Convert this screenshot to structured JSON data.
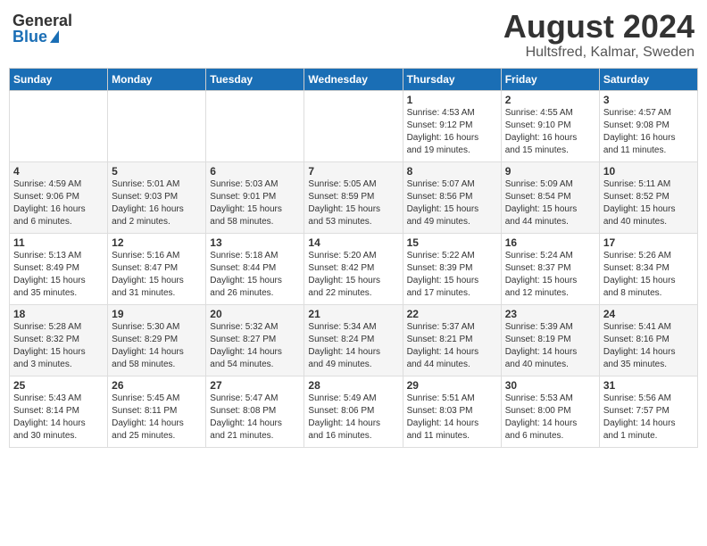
{
  "logo": {
    "general": "General",
    "blue": "Blue"
  },
  "title": {
    "month": "August 2024",
    "location": "Hultsfred, Kalmar, Sweden"
  },
  "weekdays": [
    "Sunday",
    "Monday",
    "Tuesday",
    "Wednesday",
    "Thursday",
    "Friday",
    "Saturday"
  ],
  "weeks": [
    [
      {
        "day": "",
        "info": ""
      },
      {
        "day": "",
        "info": ""
      },
      {
        "day": "",
        "info": ""
      },
      {
        "day": "",
        "info": ""
      },
      {
        "day": "1",
        "info": "Sunrise: 4:53 AM\nSunset: 9:12 PM\nDaylight: 16 hours\nand 19 minutes."
      },
      {
        "day": "2",
        "info": "Sunrise: 4:55 AM\nSunset: 9:10 PM\nDaylight: 16 hours\nand 15 minutes."
      },
      {
        "day": "3",
        "info": "Sunrise: 4:57 AM\nSunset: 9:08 PM\nDaylight: 16 hours\nand 11 minutes."
      }
    ],
    [
      {
        "day": "4",
        "info": "Sunrise: 4:59 AM\nSunset: 9:06 PM\nDaylight: 16 hours\nand 6 minutes."
      },
      {
        "day": "5",
        "info": "Sunrise: 5:01 AM\nSunset: 9:03 PM\nDaylight: 16 hours\nand 2 minutes."
      },
      {
        "day": "6",
        "info": "Sunrise: 5:03 AM\nSunset: 9:01 PM\nDaylight: 15 hours\nand 58 minutes."
      },
      {
        "day": "7",
        "info": "Sunrise: 5:05 AM\nSunset: 8:59 PM\nDaylight: 15 hours\nand 53 minutes."
      },
      {
        "day": "8",
        "info": "Sunrise: 5:07 AM\nSunset: 8:56 PM\nDaylight: 15 hours\nand 49 minutes."
      },
      {
        "day": "9",
        "info": "Sunrise: 5:09 AM\nSunset: 8:54 PM\nDaylight: 15 hours\nand 44 minutes."
      },
      {
        "day": "10",
        "info": "Sunrise: 5:11 AM\nSunset: 8:52 PM\nDaylight: 15 hours\nand 40 minutes."
      }
    ],
    [
      {
        "day": "11",
        "info": "Sunrise: 5:13 AM\nSunset: 8:49 PM\nDaylight: 15 hours\nand 35 minutes."
      },
      {
        "day": "12",
        "info": "Sunrise: 5:16 AM\nSunset: 8:47 PM\nDaylight: 15 hours\nand 31 minutes."
      },
      {
        "day": "13",
        "info": "Sunrise: 5:18 AM\nSunset: 8:44 PM\nDaylight: 15 hours\nand 26 minutes."
      },
      {
        "day": "14",
        "info": "Sunrise: 5:20 AM\nSunset: 8:42 PM\nDaylight: 15 hours\nand 22 minutes."
      },
      {
        "day": "15",
        "info": "Sunrise: 5:22 AM\nSunset: 8:39 PM\nDaylight: 15 hours\nand 17 minutes."
      },
      {
        "day": "16",
        "info": "Sunrise: 5:24 AM\nSunset: 8:37 PM\nDaylight: 15 hours\nand 12 minutes."
      },
      {
        "day": "17",
        "info": "Sunrise: 5:26 AM\nSunset: 8:34 PM\nDaylight: 15 hours\nand 8 minutes."
      }
    ],
    [
      {
        "day": "18",
        "info": "Sunrise: 5:28 AM\nSunset: 8:32 PM\nDaylight: 15 hours\nand 3 minutes."
      },
      {
        "day": "19",
        "info": "Sunrise: 5:30 AM\nSunset: 8:29 PM\nDaylight: 14 hours\nand 58 minutes."
      },
      {
        "day": "20",
        "info": "Sunrise: 5:32 AM\nSunset: 8:27 PM\nDaylight: 14 hours\nand 54 minutes."
      },
      {
        "day": "21",
        "info": "Sunrise: 5:34 AM\nSunset: 8:24 PM\nDaylight: 14 hours\nand 49 minutes."
      },
      {
        "day": "22",
        "info": "Sunrise: 5:37 AM\nSunset: 8:21 PM\nDaylight: 14 hours\nand 44 minutes."
      },
      {
        "day": "23",
        "info": "Sunrise: 5:39 AM\nSunset: 8:19 PM\nDaylight: 14 hours\nand 40 minutes."
      },
      {
        "day": "24",
        "info": "Sunrise: 5:41 AM\nSunset: 8:16 PM\nDaylight: 14 hours\nand 35 minutes."
      }
    ],
    [
      {
        "day": "25",
        "info": "Sunrise: 5:43 AM\nSunset: 8:14 PM\nDaylight: 14 hours\nand 30 minutes."
      },
      {
        "day": "26",
        "info": "Sunrise: 5:45 AM\nSunset: 8:11 PM\nDaylight: 14 hours\nand 25 minutes."
      },
      {
        "day": "27",
        "info": "Sunrise: 5:47 AM\nSunset: 8:08 PM\nDaylight: 14 hours\nand 21 minutes."
      },
      {
        "day": "28",
        "info": "Sunrise: 5:49 AM\nSunset: 8:06 PM\nDaylight: 14 hours\nand 16 minutes."
      },
      {
        "day": "29",
        "info": "Sunrise: 5:51 AM\nSunset: 8:03 PM\nDaylight: 14 hours\nand 11 minutes."
      },
      {
        "day": "30",
        "info": "Sunrise: 5:53 AM\nSunset: 8:00 PM\nDaylight: 14 hours\nand 6 minutes."
      },
      {
        "day": "31",
        "info": "Sunrise: 5:56 AM\nSunset: 7:57 PM\nDaylight: 14 hours\nand 1 minute."
      }
    ]
  ]
}
